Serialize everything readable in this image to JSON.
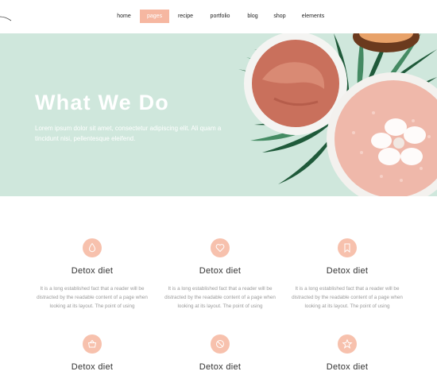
{
  "nav": {
    "items": [
      {
        "label": "home",
        "active": false
      },
      {
        "label": "pages",
        "active": true
      },
      {
        "label": "recipe",
        "active": false
      },
      {
        "label": "portfolio",
        "active": false
      },
      {
        "label": "blog",
        "active": false
      },
      {
        "label": "shop",
        "active": false
      },
      {
        "label": "elements",
        "active": false
      }
    ]
  },
  "hero": {
    "title": "What We Do",
    "text": "Lorem ipsum dolor sit amet, consectetur adipiscing elit. Ali quam a tincidunt nisi, pellentesque eleifend."
  },
  "services": [
    {
      "icon": "drop-icon",
      "title": "Detox diet",
      "text": "It is a long established fact that a reader will be distracted by the readable content of a page when looking at its layout. The point of using"
    },
    {
      "icon": "heart-icon",
      "title": "Detox diet",
      "text": "It is a long established fact that a reader will be distracted by the readable content of a page when looking at its layout. The point of using"
    },
    {
      "icon": "bookmark-icon",
      "title": "Detox diet",
      "text": "It is a long established fact that a reader will be distracted by the readable content of a page when looking at its layout. The point of using"
    },
    {
      "icon": "basket-icon",
      "title": "Detox diet"
    },
    {
      "icon": "no-sign-icon",
      "title": "Detox diet"
    },
    {
      "icon": "star-icon",
      "title": "Detox diet"
    }
  ],
  "colors": {
    "accent": "#f6b7a1",
    "hero_bg": "#cfe7dc",
    "text_dark": "#333333",
    "text_muted": "#9a9a9a"
  }
}
